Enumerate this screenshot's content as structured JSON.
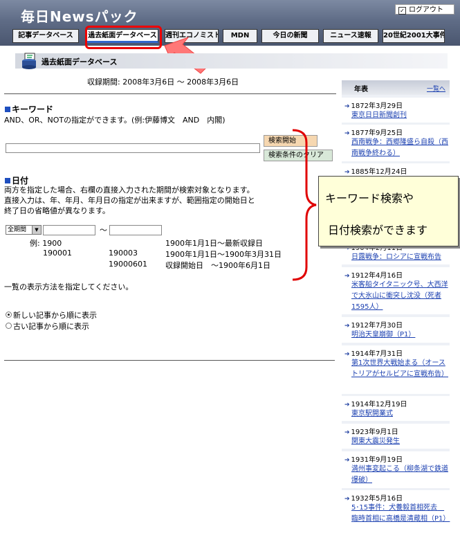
{
  "header": {
    "logo": "毎日Newsパック",
    "logout_label": "ログアウト"
  },
  "tabs": [
    {
      "label": "記事データベース"
    },
    {
      "label": "過去紙面データベース"
    },
    {
      "label": "週刊エコノミスト"
    },
    {
      "label": "MDN"
    },
    {
      "label": "今日の新聞"
    },
    {
      "label": "ニュース速報"
    },
    {
      "label": "20世紀2001大事件"
    }
  ],
  "subheader": {
    "title": "過去紙面データベース"
  },
  "period": "収録期間: 2008年3月6日 ～ 2008年3月6日",
  "keyword": {
    "title": "キーワード",
    "desc": "AND、OR、NOTの指定ができます。(例:伊藤博文　AND　内閣)",
    "search_label": "検索開始",
    "clear_label": "検索条件のクリア"
  },
  "date": {
    "title": "日付",
    "desc1": "両方を指定した場合、右欄の直接入力された期間が検索対象となります。",
    "desc2": "直接入力は、年、年月、年月日の指定が出来ますが、範囲指定の開始日と",
    "desc3": "終了日の省略値が異なります。",
    "select_value": "全期間",
    "tilde": "～",
    "ex_label": "例: 1900",
    "ex1_right": "1900年1月1日～最新収録日",
    "ex2_mid_left": "190001",
    "ex2_mid": "190003",
    "ex2_right": "1900年1月1日～1900年3月31日",
    "ex3_mid": "19000601",
    "ex3_right": "収録開始日　～1900年6月1日"
  },
  "display": {
    "prompt": "一覧の表示方法を指定してください。",
    "opt_new": "新しい記事から順に表示",
    "opt_old": "古い記事から順に表示"
  },
  "sidebar": {
    "title": "年表",
    "more": "一覧へ",
    "entries": [
      {
        "date": "1872年3月29日",
        "link": "東京日日新聞創刊"
      },
      {
        "date": "1877年9月25日",
        "link": "西南戦争：西郷隆盛ら自殺（西南戦争終わる）"
      },
      {
        "date": "1885年12月24日",
        "link": ""
      },
      {
        "date": "1904年2月11日",
        "link": "日露戦争：ロシアに宣戦布告"
      },
      {
        "date": "1912年4月16日",
        "link": "米客船タイタニック号、大西洋で大氷山に衝突し沈没（死者1595人）"
      },
      {
        "date": "1912年7月30日",
        "link": "明治天皇崩御（P1）"
      },
      {
        "date": "1914年7月31日",
        "link": "第1次世界大戦始まる（オーストリアがセルビアに宣戦布告）"
      },
      {
        "date": "1914年12月19日",
        "link": "東京駅開業式"
      },
      {
        "date": "1923年9月1日",
        "link": "関東大震災発生"
      },
      {
        "date": "1931年9月19日",
        "link": "満州事変起こる（柳条湖で鉄道爆破）"
      },
      {
        "date": "1932年5月16日",
        "link": "5･15事件：犬養毅首相死去　臨時首相に高橋是清蔵相（P1）"
      }
    ]
  },
  "callout": {
    "line1": "キーワード検索や",
    "line2": "日付検索ができます"
  },
  "colors": {
    "header_bg": "#5f6c86",
    "highlight": "#e00000",
    "link": "#1a3fb0",
    "note_bg": "#ffffd9"
  }
}
